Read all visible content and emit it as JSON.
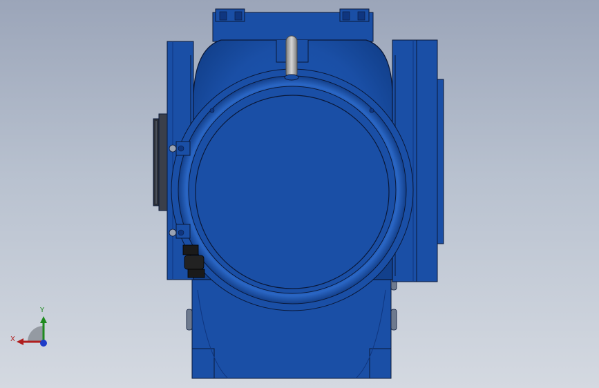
{
  "viewport": {
    "background_top": "#9ba5b9",
    "background_bottom": "#d4d9e1"
  },
  "model": {
    "name": "gear-reducer-motor",
    "body_color": "#1a4fa6",
    "body_dark": "#0f3680",
    "edge_color": "#0a1838",
    "lifting_eye_color": "#a9a9a9",
    "cable_gland_color": "#1a1a1a"
  },
  "triad": {
    "x_label": "X",
    "y_label": "Y",
    "x_color": "#b01e1e",
    "y_color": "#1e8a1e"
  }
}
